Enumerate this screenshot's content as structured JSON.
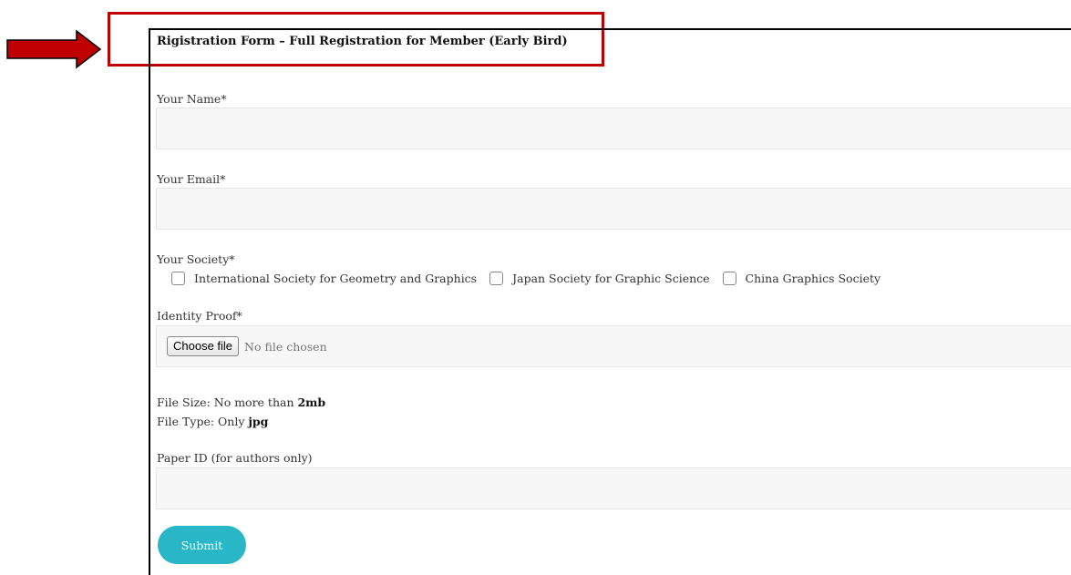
{
  "form": {
    "title": "Rigistration Form – Full Registration for Member (Early Bird)",
    "name_label": "Your Name*",
    "name_value": "",
    "email_label": "Your Email*",
    "email_value": "",
    "society_label": "Your Society*",
    "society_options": [
      {
        "label": "International Society for Geometry and Graphics",
        "checked": false
      },
      {
        "label": "Japan Society for Graphic Science",
        "checked": false
      },
      {
        "label": "China Graphics Society",
        "checked": false
      }
    ],
    "identity_label": "Identity Proof*",
    "file_button": "Choose file",
    "file_status": "No file chosen",
    "file_size_prefix": "File Size: No more than ",
    "file_size_value": "2mb",
    "file_type_prefix": "File Type: Only ",
    "file_type_value": "jpg",
    "paper_id_label": "Paper ID (for authors only)",
    "paper_id_value": "",
    "submit_label": "Submit"
  },
  "annotation": {
    "arrow_color": "#c00000",
    "box_color": "#c00000"
  },
  "colors": {
    "submit_bg": "#29b6c6",
    "field_bg": "#f7f7f7"
  }
}
